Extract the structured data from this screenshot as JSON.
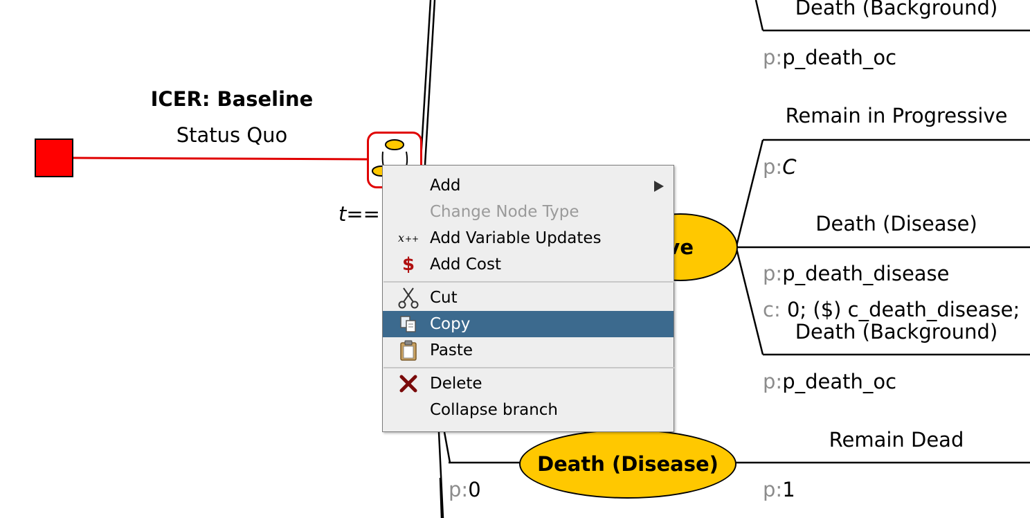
{
  "tree": {
    "decision": {
      "name": "ICER: Baseline",
      "branch_label": "Status Quo"
    },
    "markov": {
      "termination_condition": "t=="
    },
    "states": {
      "progressive_fragment": "ve",
      "death_disease": "Death (Disease)"
    },
    "right_column": {
      "top_branch": "Death (Background)",
      "p_death_oc_1_prefix": "p:",
      "p_death_oc_1_value": "p_death_oc",
      "remain_progressive": "Remain in Progressive",
      "pc_prefix": "p:",
      "pc_value": "C",
      "death_disease_branch": "Death (Disease)",
      "p_death_disease_prefix": "p:",
      "p_death_disease_value": "p_death_disease",
      "cost_prefix": "c:",
      "cost_value": "0; ($) c_death_disease;",
      "death_background_2": "Death (Background)",
      "p_death_oc_2_prefix": "p:",
      "p_death_oc_2_value": "p_death_oc",
      "remain_dead": "Remain Dead",
      "p1_prefix": "p:",
      "p1_value": "1"
    },
    "bottom": {
      "p0_prefix": "p:",
      "p0_value": "0"
    }
  },
  "context_menu": {
    "items": [
      {
        "label": "Add",
        "icon": "",
        "submenu": true,
        "enabled": true
      },
      {
        "label": "Change Node Type",
        "icon": "",
        "enabled": false
      },
      {
        "label": "Add Variable Updates",
        "icon": "variable-update-icon",
        "enabled": true
      },
      {
        "label": "Add Cost",
        "icon": "dollar-icon",
        "enabled": true
      },
      {
        "label": "Cut",
        "icon": "scissors-icon",
        "enabled": true
      },
      {
        "label": "Copy",
        "icon": "copy-icon",
        "enabled": true,
        "selected": true
      },
      {
        "label": "Paste",
        "icon": "clipboard-icon",
        "enabled": true
      },
      {
        "label": "Delete",
        "icon": "delete-x-icon",
        "enabled": true
      },
      {
        "label": "Collapse branch",
        "icon": "",
        "enabled": true
      }
    ],
    "selected_color": "#3c6a8e"
  },
  "colors": {
    "node_yellow": "#ffc800",
    "decision_red": "#ff0000",
    "highlight_red": "#e00000"
  }
}
